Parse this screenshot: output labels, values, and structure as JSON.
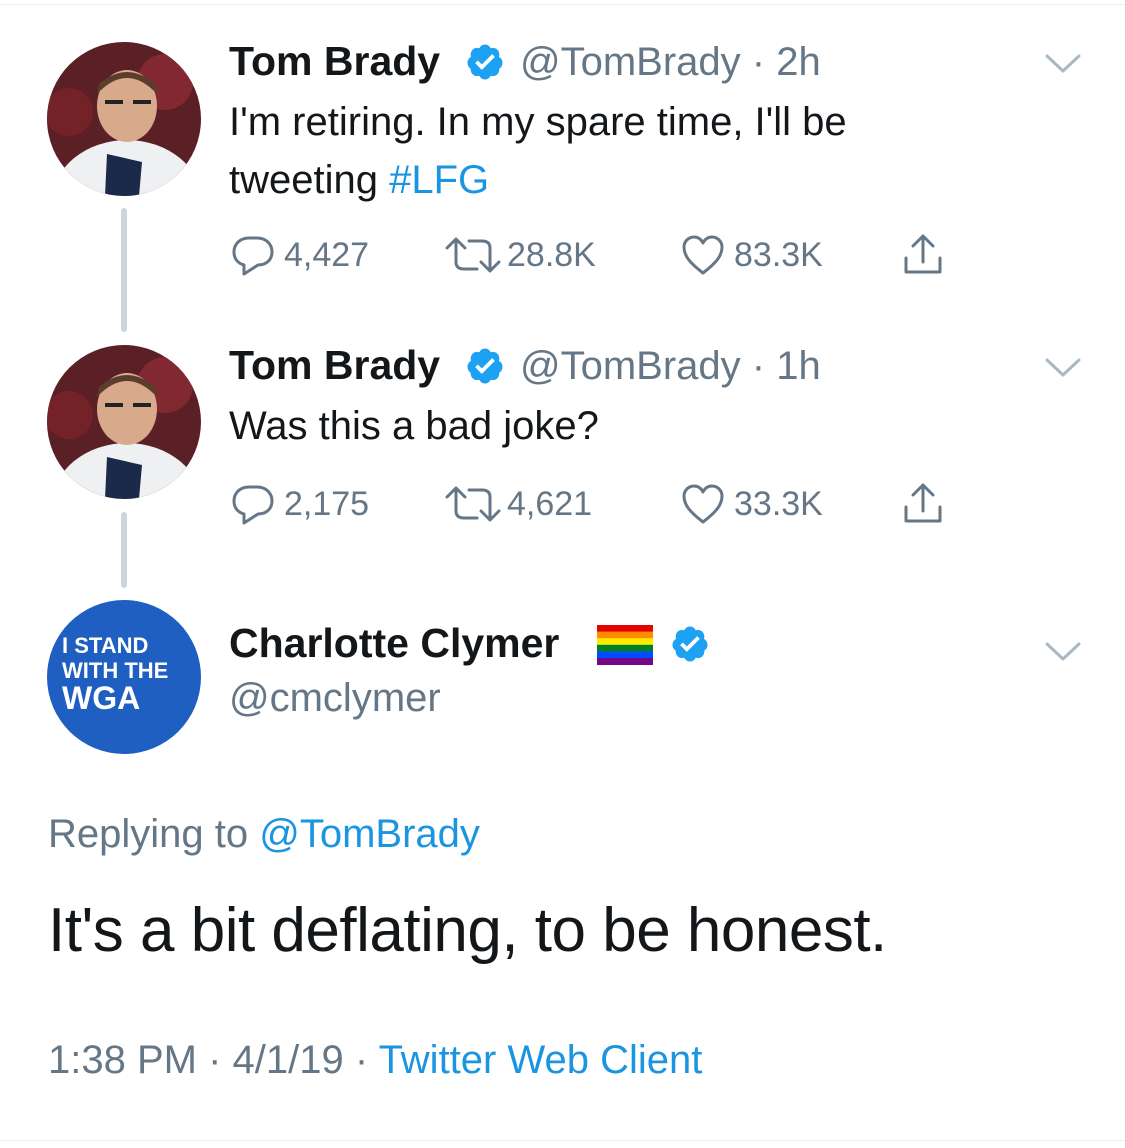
{
  "thread": {
    "tweets": [
      {
        "name": "Tom Brady",
        "handle": "@TomBrady",
        "time": "2h",
        "text_line1": "I'm retiring. In my spare time, I'll be",
        "text_line2_prefix": "tweeting ",
        "hashtag": "#LFG",
        "replies": "4,427",
        "retweets": "28.8K",
        "likes": "83.3K"
      },
      {
        "name": "Tom Brady",
        "handle": "@TomBrady",
        "time": "1h",
        "text_line1": "Was this a bad joke?",
        "replies": "2,175",
        "retweets": "4,621",
        "likes": "33.3K"
      }
    ]
  },
  "reply": {
    "name": "Charlotte Clymer",
    "handle": "@cmclymer",
    "avatar_lines": [
      "I STAND",
      "WITH THE",
      "WGA"
    ],
    "replying_prefix": "Replying to ",
    "replying_to": "@TomBrady",
    "text": "It's a bit deflating, to be honest.",
    "time": "1:38 PM",
    "date": "4/1/19",
    "client": "Twitter Web Client"
  },
  "separator": " · ",
  "colors": {
    "accent": "#1b95e0",
    "secondary_text": "#657786",
    "primary_text": "#14171a",
    "verified": "#1da1f2",
    "wga_blue": "#1f5fc2"
  },
  "icons": [
    "verified-badge-icon",
    "chevron-down-icon",
    "reply-icon",
    "retweet-icon",
    "like-icon",
    "share-icon",
    "rainbow-flag-icon"
  ]
}
